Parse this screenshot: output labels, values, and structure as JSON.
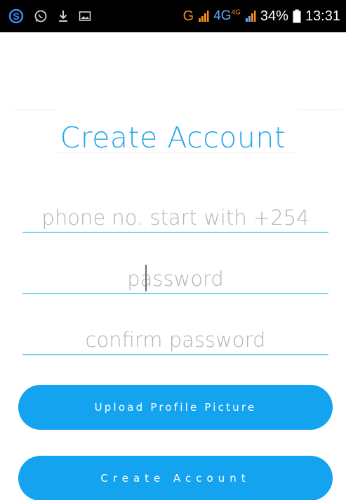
{
  "status_bar": {
    "left_icons": [
      "skype-icon",
      "whatsapp-icon",
      "download-icon",
      "image-icon"
    ],
    "network_g": "G",
    "network_4g": "4G",
    "network_4g_small": "4G",
    "battery": "34%",
    "time": "13:31"
  },
  "form": {
    "title": "Create Account",
    "phone_placeholder": "phone no. start with +254",
    "password_placeholder": "password",
    "confirm_placeholder": "confirm password"
  },
  "buttons": {
    "upload_label": "Upload Profile Picture",
    "create_label": "Create Account"
  },
  "colors": {
    "accent": "#14a4ef",
    "title": "#27a7ea",
    "underline": "#7fd1ec",
    "status_bar": "#000000",
    "network_g": "#f48a1a"
  }
}
